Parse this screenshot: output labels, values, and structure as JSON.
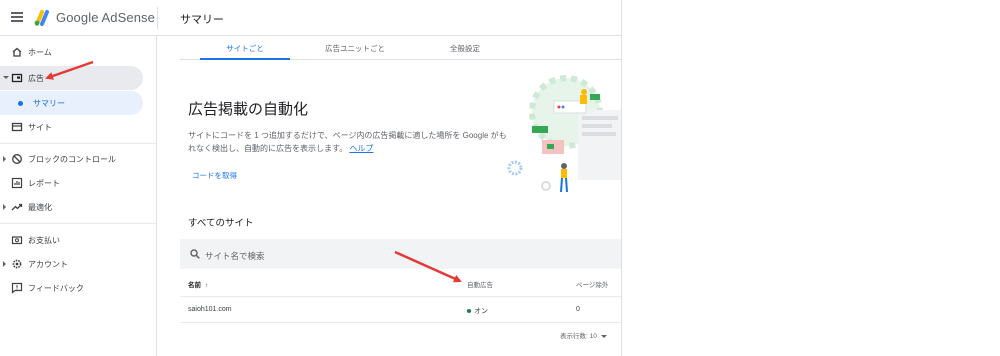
{
  "header": {
    "brand": "Google AdSense",
    "page_title": "サマリー"
  },
  "sidebar": {
    "items": [
      {
        "label": "ホーム",
        "icon": "home-icon"
      },
      {
        "label": "広告",
        "icon": "ad-icon"
      },
      {
        "label": "サマリー",
        "icon": "dot"
      },
      {
        "label": "サイト",
        "icon": "site-icon"
      },
      {
        "label": "ブロックのコントロール",
        "icon": "block-icon"
      },
      {
        "label": "レポート",
        "icon": "report-icon"
      },
      {
        "label": "最適化",
        "icon": "trending-icon"
      },
      {
        "label": "お支払い",
        "icon": "payment-icon"
      },
      {
        "label": "アカウント",
        "icon": "gear-icon"
      },
      {
        "label": "フィードバック",
        "icon": "feedback-icon"
      }
    ]
  },
  "tabs": [
    {
      "label": "サイトごと"
    },
    {
      "label": "広告ユニットごと"
    },
    {
      "label": "全般設定"
    }
  ],
  "hero": {
    "title": "広告掲載の自動化",
    "desc": "サイトにコードを 1 つ追加するだけで、ページ内の広告掲載に適した場所を Google がもれなく検出し、自動的に広告を表示します。",
    "help_link": "ヘルプ",
    "get_code": "コードを取得"
  },
  "sites": {
    "title": "すべてのサイト",
    "search_placeholder": "サイト名で検索",
    "columns": [
      "名前",
      "自動広告",
      "ページ除外"
    ],
    "rows": [
      {
        "name": "saioh101.com",
        "auto_ads": "オン",
        "page_exclusions": "0"
      }
    ],
    "rows_per_page_label": "表示行数:",
    "rows_per_page": "10"
  },
  "colors": {
    "accent": "#1a73e8",
    "status_on": "#188038",
    "annotation_arrow": "#e53935"
  }
}
